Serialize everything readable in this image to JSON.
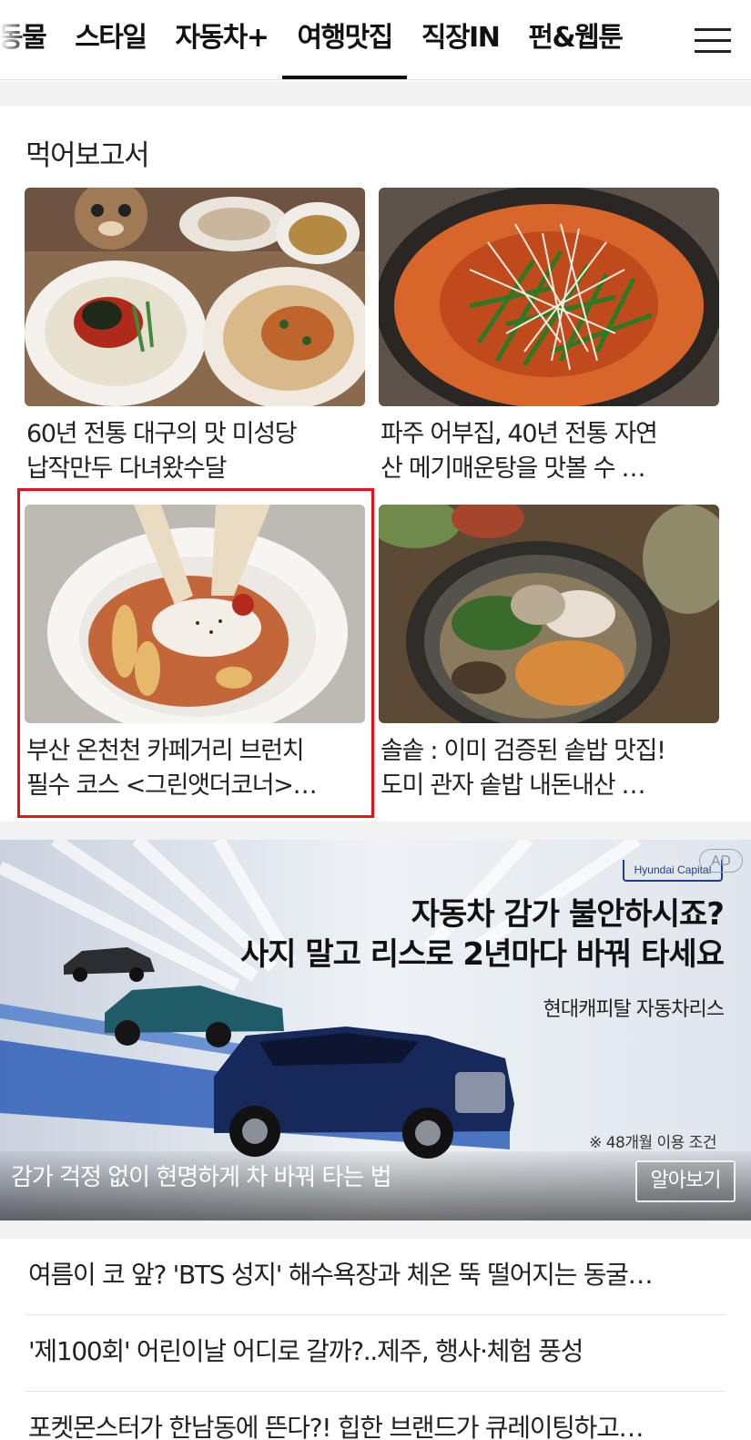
{
  "nav": {
    "tabs": [
      {
        "label": "동물"
      },
      {
        "label": "스타일"
      },
      {
        "label": "자동차+"
      },
      {
        "label": "여행맛집"
      },
      {
        "label": "직장IN"
      },
      {
        "label": "펀&웹툰"
      }
    ],
    "active_tab": "여행맛집",
    "menu_icon": "hamburger-menu-icon"
  },
  "section": {
    "title": "먹어보고서",
    "cards": [
      {
        "line1": "60년 전통 대구의 맛 미성당",
        "line2": "납작만두 다녀왔수달"
      },
      {
        "line1": "파주 어부집, 40년 전통 자연",
        "line2": "산 메기매운탕을 맛볼 수 …"
      },
      {
        "line1": "부산 온천천 카페거리 브런치",
        "line2": "필수 코스 <그린앳더코너>…"
      },
      {
        "line1": "솔솥 : 이미 검증된 솥밥 맛집!",
        "line2": "도미 관자 솥밥 내돈내산 …"
      }
    ],
    "highlight_color": "#e1141e"
  },
  "ad": {
    "brand": "Hyundai Capital",
    "badge": "AD",
    "headline_line1": "자동차 감가 불안하시죠?",
    "headline_line2": "사지 말고 리스로 2년마다 바꿔 타세요",
    "subline": "현대캐피탈 자동차리스",
    "note": "※ 48개월 이용 조건",
    "tagline": "감가 걱정 없이 현명하게 차 바꿔 타는 법",
    "cta": "알아보기"
  },
  "headlines": [
    "여름이 코 앞? 'BTS 성지' 해수욕장과 체온 뚝 떨어지는 동굴…",
    "'제100회' 어린이날 어디로 갈까?..제주, 행사·체험 풍성",
    "포켓몬스터가 한남동에 뜬다?! 힙한 브랜드가 큐레이팅하고…"
  ]
}
